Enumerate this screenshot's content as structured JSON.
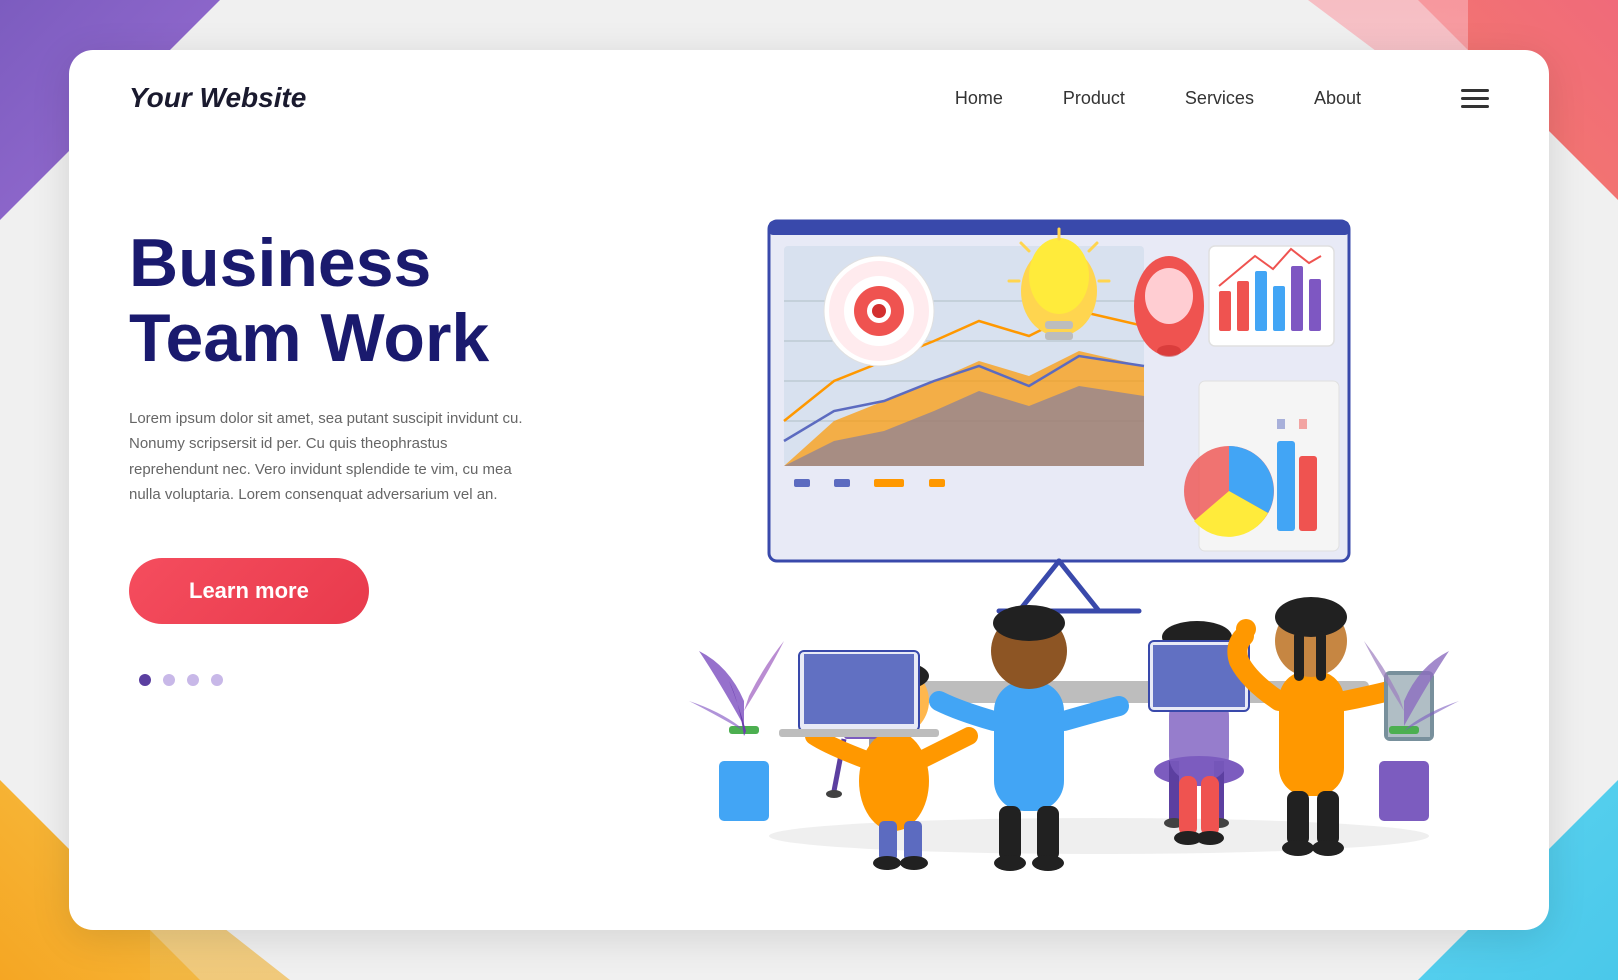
{
  "background": {
    "corners": [
      "tl",
      "tr",
      "bl",
      "br"
    ]
  },
  "header": {
    "logo": "Your Website",
    "nav": {
      "items": [
        {
          "label": "Home",
          "id": "home"
        },
        {
          "label": "Product",
          "id": "product"
        },
        {
          "label": "Services",
          "id": "services"
        },
        {
          "label": "About",
          "id": "about"
        }
      ]
    },
    "hamburger_label": "menu"
  },
  "hero": {
    "title_line1": "Business",
    "title_line2": "Team Work",
    "description": "Lorem ipsum dolor sit amet, sea putant suscipit invidunt cu. Nonumy scripsersit id per. Cu quis theophrastus reprehendunt nec. Vero invidunt splendide te vim, cu mea nulla voluptaria. Lorem consenquat adversarium vel an.",
    "cta_label": "Learn more"
  },
  "dots": {
    "items": [
      {
        "active": true
      },
      {
        "active": false
      },
      {
        "active": false
      },
      {
        "active": false
      }
    ]
  },
  "colors": {
    "title": "#1a1a6e",
    "cta_bg": "#f54d5e",
    "cta_text": "#ffffff",
    "dot_active": "#5b3fa0",
    "dot_inactive": "#c8b8e8"
  }
}
